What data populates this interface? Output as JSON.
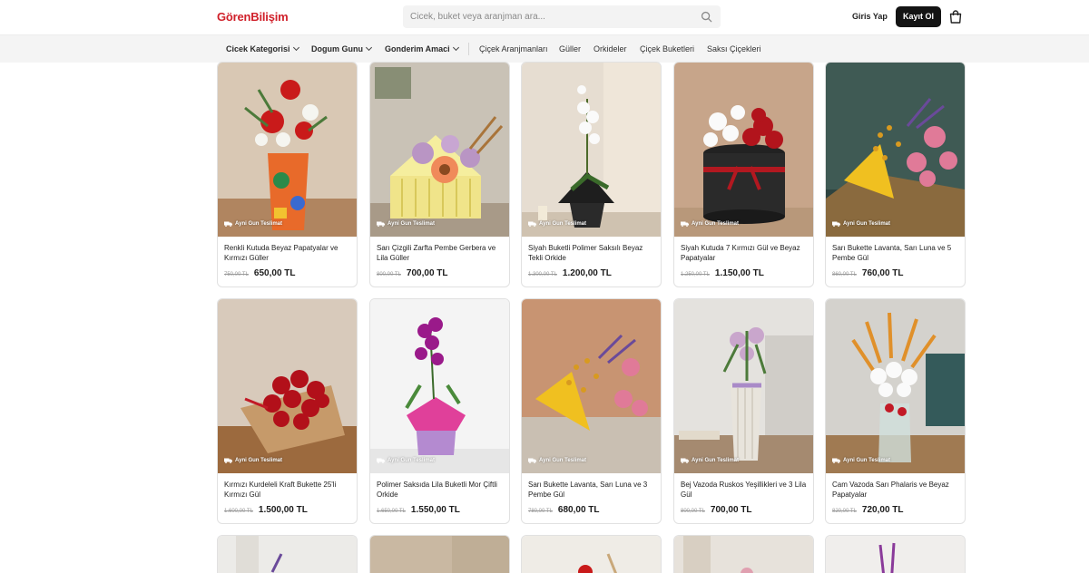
{
  "header": {
    "logo": "GörenBilişim",
    "search_placeholder": "Cicek, buket veya aranjman ara...",
    "login_label": "Giris Yap",
    "register_label": "Kayıt Ol"
  },
  "nav": {
    "dropdowns": [
      "Cicek Kategorisi",
      "Dogum Gunu",
      "Gonderim Amaci"
    ],
    "links": [
      "Çiçek Aranjmanları",
      "Güller",
      "Orkideler",
      "Çiçek Buketleri",
      "Saksı Çiçekleri"
    ]
  },
  "badge_label": "Ayni Gun Teslimat",
  "products": [
    {
      "title": "Renkli Kutuda Beyaz Papatyalar ve Kırmızı Güller",
      "old_price": "750,00 TL",
      "price": "650,00 TL"
    },
    {
      "title": "Sarı Çizgili Zarfta Pembe Gerbera ve Lila Güller",
      "old_price": "800,00 TL",
      "price": "700,00 TL"
    },
    {
      "title": "Siyah Buketli Polimer Saksılı Beyaz Tekli Orkide",
      "old_price": "1.300,00 TL",
      "price": "1.200,00 TL"
    },
    {
      "title": "Siyah Kutuda 7 Kırmızı Gül ve Beyaz Papatyalar",
      "old_price": "1.250,00 TL",
      "price": "1.150,00 TL"
    },
    {
      "title": "Sarı Bukette Lavanta, Sarı Luna ve 5 Pembe Gül",
      "old_price": "860,00 TL",
      "price": "760,00 TL"
    },
    {
      "title": "Kırmızı Kurdeleli Kraft Bukette 25'li Kırmızı Gül",
      "old_price": "1.600,00 TL",
      "price": "1.500,00 TL"
    },
    {
      "title": "Polimer Saksıda Lila Buketli Mor Çiftli Orkide",
      "old_price": "1.650,00 TL",
      "price": "1.550,00 TL"
    },
    {
      "title": "Sarı Bukette Lavanta, Sarı Luna ve 3 Pembe Gül",
      "old_price": "780,00 TL",
      "price": "680,00 TL"
    },
    {
      "title": "Bej Vazoda Ruskos Yeşillikleri ve 3 Lila Gül",
      "old_price": "800,00 TL",
      "price": "700,00 TL"
    },
    {
      "title": "Cam Vazoda Sarı Phalaris ve Beyaz Papatyalar",
      "old_price": "820,00 TL",
      "price": "720,00 TL"
    }
  ],
  "colors": {
    "brand": "#d0202a",
    "button_dark": "#141414",
    "nav_bg": "#f4f4f4"
  },
  "icons": [
    "search-icon",
    "cart-icon",
    "truck-icon",
    "chevron-down-icon"
  ]
}
